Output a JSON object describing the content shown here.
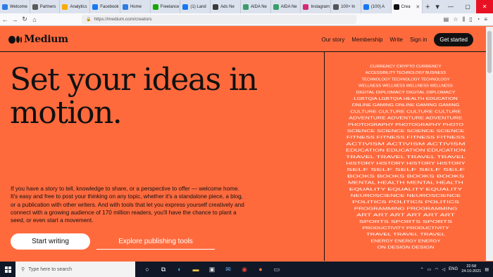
{
  "browser": {
    "tabs": [
      {
        "label": "Welcome",
        "color": "#2d7be5"
      },
      {
        "label": "Partners",
        "color": "#5a5a5a"
      },
      {
        "label": "Analytics",
        "color": "#f9ab00"
      },
      {
        "label": "Facebook",
        "color": "#1877f2"
      },
      {
        "label": "Home",
        "color": "#2d7be5"
      },
      {
        "label": "Freelance",
        "color": "#14a800"
      },
      {
        "label": "(1) Land",
        "color": "#1877f2"
      },
      {
        "label": "Ads Ne",
        "color": "#3a3a3a"
      },
      {
        "label": "AIDA Ne",
        "color": "#3a9e6a"
      },
      {
        "label": "AIDA Ne",
        "color": "#3a9e6a"
      },
      {
        "label": "Instagram",
        "color": "#d62976"
      },
      {
        "label": "100+ In",
        "color": "#555555"
      },
      {
        "label": "(100) A",
        "color": "#1877f2"
      }
    ],
    "active_tab": {
      "label": "Crea",
      "color": "#111111"
    },
    "url": "https://medium.com/creators",
    "window_controls": [
      "—",
      "▢",
      "✕"
    ]
  },
  "medium": {
    "logo_text": "Medium",
    "nav": [
      "Our story",
      "Membership",
      "Write",
      "Sign in"
    ],
    "cta": "Get started",
    "headline_line1": "Set your ideas in",
    "headline_line2": "motion.",
    "intro": "If you have a story to tell, knowledge to share, or a perspective to offer — welcome home. It's easy and free to post your thinking on any topic, whether it's a standalone piece, a blog, or a publication with other writers. And with tools that let you express yourself creatively and connect with a growing audience of 170 million readers, you'll have the chance to plant a seed, or even start a movement.",
    "btn_start": "Start writing",
    "btn_explore": "Explore publishing tools",
    "wordart_topics": [
      "CURRENCY CRYPTO CURRENCY",
      "ACCESSIBILITY TECHNOLOGY BUSINESS",
      "TECHNOLOGY TECHNOLOGY TECHNOLOGY",
      "WELLNESS WELLNESS WELLNESS WELLNESS",
      "DIGITAL DIPLOMACY DIGITAL DIPLOMACY",
      "LGBTQIA LGBTQIA HEALTH EDUCATION",
      "ONLINE GAMING ONLINE GAMING GAMING",
      "CULTURE CULTURE CULTURE CULTURE",
      "ADVENTURE ADVENTURE ADVENTURE",
      "PHOTOGRAPHY PHOTOGRAPHY PHOTO",
      "SCIENCE SCIENCE SCIENCE SCIENCE",
      "FITNESS FITNESS FITNESS FITNESS",
      "ACTIVISM ACTIVISM ACTIVISM",
      "EDUCATION EDUCATION EDUCATION",
      "TRAVEL TRAVEL TRAVEL TRAVEL",
      "HISTORY HISTORY HISTORY HISTORY",
      "SELF SELF SELF SELF SELF",
      "BOOKS BOOKS BOOKS BOOKS",
      "MENTAL HEALTH MENTAL HEALTH",
      "EQUALITY EQUALITY EQUALITY",
      "NEUROSCIENCE NEUROSCIENCE",
      "POLITICS POLITICS POLITICS",
      "PROGRAMMING PROGRAMMING",
      "ART ART ART ART ART ART",
      "SPORTS SPORTS SPORTS",
      "PRODUCTIVITY PRODUCTIVITY",
      "TRAVEL TRAVEL TRAVEL",
      "ENERGY ENERGY ENERGY",
      "ON DESIGN DESIGN"
    ]
  },
  "taskbar": {
    "search_placeholder": "Type here to search",
    "lang": "ENG",
    "time": "22:58",
    "date": "24-10-2021"
  }
}
